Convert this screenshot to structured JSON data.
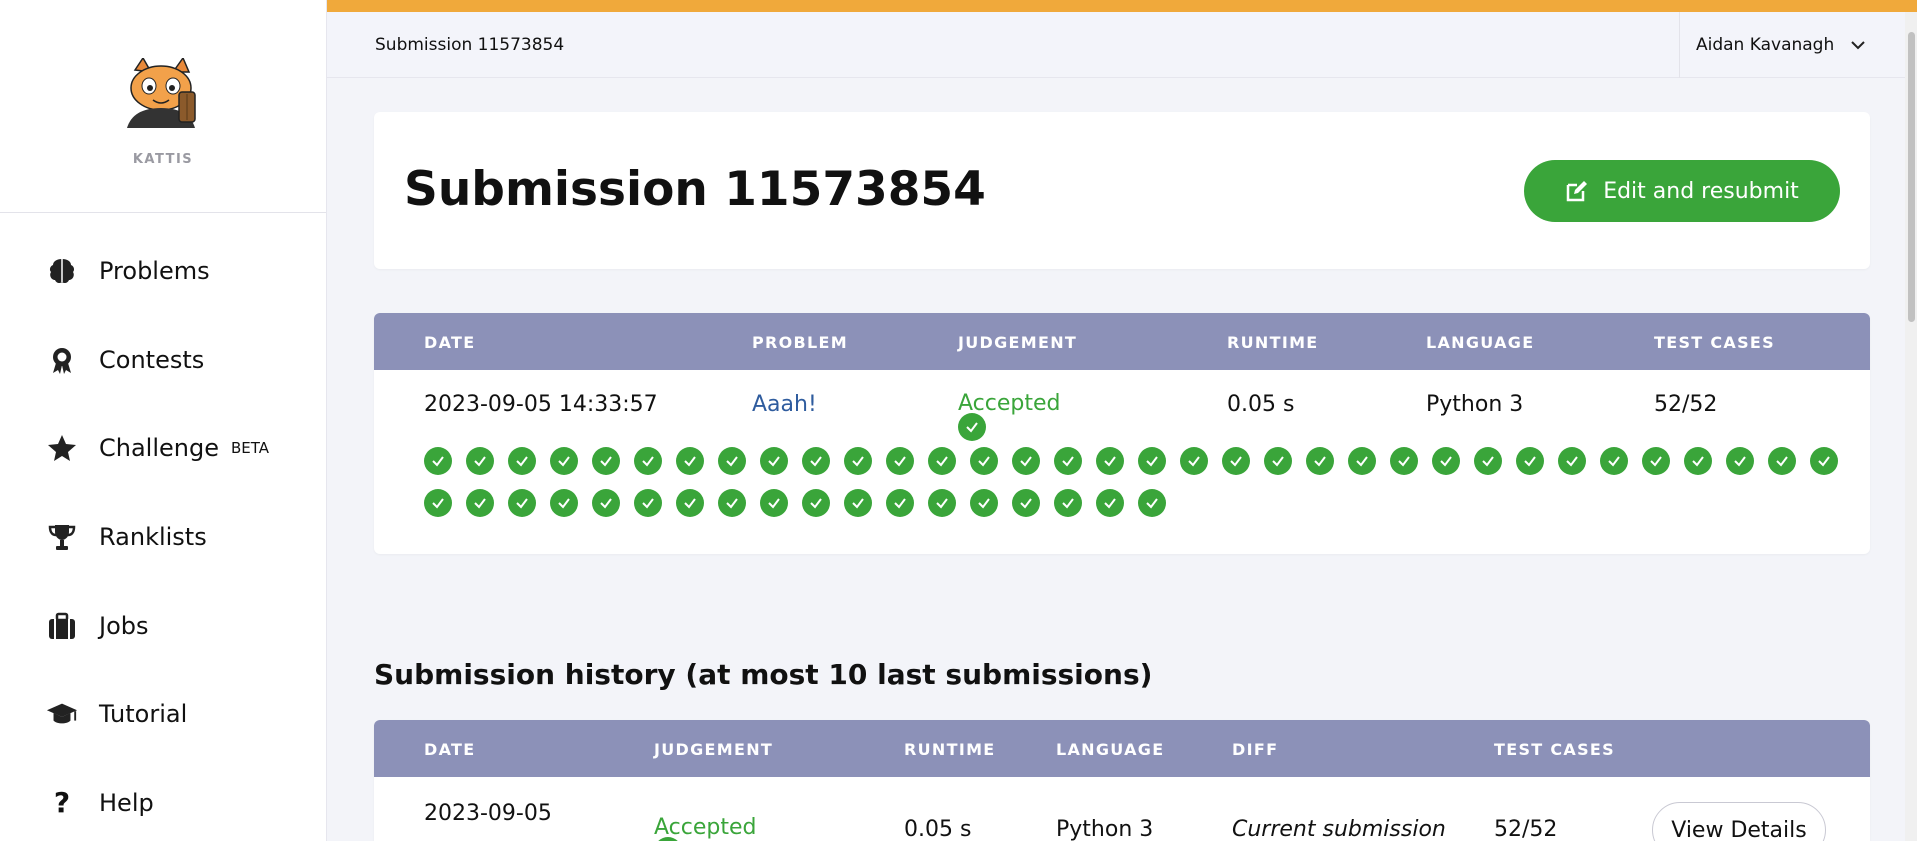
{
  "sidebar": {
    "brand": "KATTIS",
    "items": [
      {
        "label": "Problems",
        "icon": "brain-icon"
      },
      {
        "label": "Contests",
        "icon": "award-icon"
      },
      {
        "label": "Challenge",
        "icon": "star-icon",
        "badge": "BETA"
      },
      {
        "label": "Ranklists",
        "icon": "trophy-icon"
      },
      {
        "label": "Jobs",
        "icon": "briefcase-icon"
      },
      {
        "label": "Tutorial",
        "icon": "graduation-cap-icon"
      },
      {
        "label": "Help",
        "icon": "question-icon"
      }
    ]
  },
  "topbar": {
    "breadcrumb": "Submission 11573854",
    "user": "Aidan Kavanagh"
  },
  "colors": {
    "accent_bar": "#f0a93b",
    "success": "#3aa53a",
    "table_header": "#8c91b8",
    "link": "#2f5c9e"
  },
  "submission": {
    "title": "Submission 11573854",
    "edit_button": "Edit and resubmit",
    "headers": [
      "DATE",
      "PROBLEM",
      "JUDGEMENT",
      "RUNTIME",
      "LANGUAGE",
      "TEST CASES"
    ],
    "row": {
      "date": "2023-09-05 14:33:57",
      "problem": "Aaah!",
      "judgement": "Accepted",
      "runtime": "0.05 s",
      "language": "Python 3",
      "test_cases": "52/52"
    },
    "test_cases_passed": 52
  },
  "history": {
    "title": "Submission history (at most 10 last submissions)",
    "headers": [
      "DATE",
      "JUDGEMENT",
      "RUNTIME",
      "LANGUAGE",
      "DIFF",
      "TEST CASES"
    ],
    "rows": [
      {
        "date": "2023-09-05",
        "judgement": "Accepted",
        "runtime": "0.05 s",
        "language": "Python 3",
        "diff": "Current submission",
        "test_cases": "52/52",
        "action": "View Details"
      }
    ]
  }
}
